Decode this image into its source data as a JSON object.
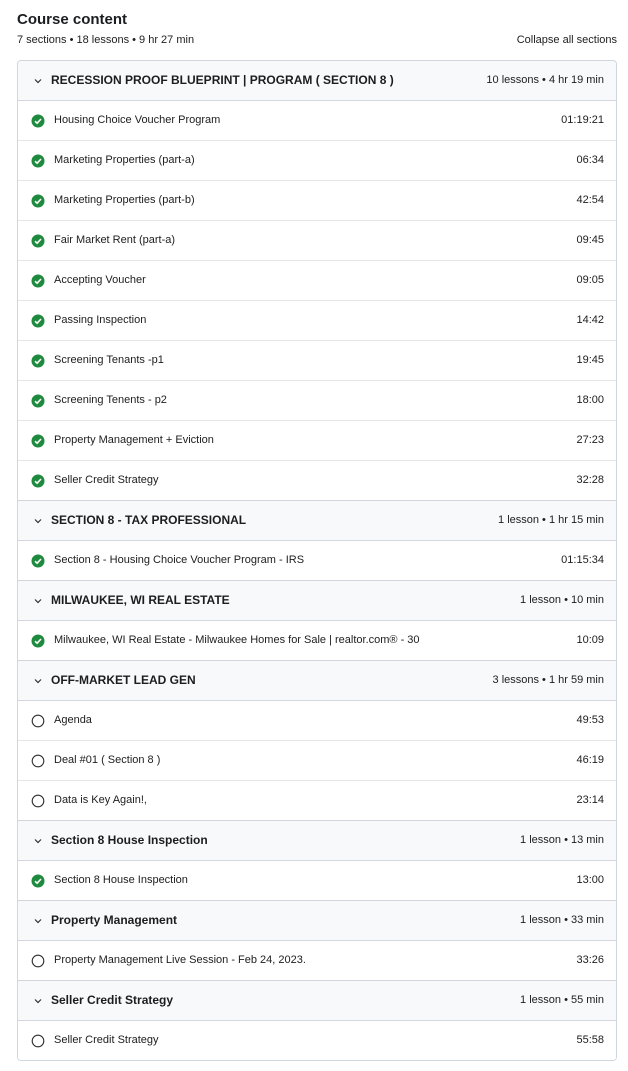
{
  "header": {
    "title": "Course content",
    "summary": "7 sections • 18 lessons • 9 hr 27 min",
    "collapse_label": "Collapse all sections"
  },
  "colors": {
    "complete": "#1e8a3e",
    "border": "#d1d7dc",
    "section_bg": "#f7f9fa"
  },
  "sections": [
    {
      "title": "RECESSION PROOF BLUEPRINT | PROGRAM ( SECTION 8 )",
      "meta": "10 lessons • 4 hr 19 min",
      "lessons": [
        {
          "title": "Housing Choice Voucher Program",
          "duration": "01:19:21",
          "complete": true
        },
        {
          "title": "Marketing Properties (part-a)",
          "duration": "06:34",
          "complete": true
        },
        {
          "title": "Marketing Properties (part-b)",
          "duration": "42:54",
          "complete": true
        },
        {
          "title": "Fair Market Rent (part-a)",
          "duration": "09:45",
          "complete": true
        },
        {
          "title": "Accepting Voucher",
          "duration": "09:05",
          "complete": true
        },
        {
          "title": "Passing Inspection",
          "duration": "14:42",
          "complete": true
        },
        {
          "title": "Screening Tenants -p1",
          "duration": "19:45",
          "complete": true
        },
        {
          "title": "Screening Tenents - p2",
          "duration": "18:00",
          "complete": true
        },
        {
          "title": "Property Management + Eviction",
          "duration": "27:23",
          "complete": true
        },
        {
          "title": "Seller Credit Strategy",
          "duration": "32:28",
          "complete": true
        }
      ]
    },
    {
      "title": "SECTION 8 - TAX PROFESSIONAL",
      "meta": "1 lesson • 1 hr 15 min",
      "lessons": [
        {
          "title": "Section 8 - Housing Choice Voucher Program - IRS",
          "duration": "01:15:34",
          "complete": true
        }
      ]
    },
    {
      "title": "MILWAUKEE, WI REAL ESTATE",
      "meta": "1 lesson • 10 min",
      "lessons": [
        {
          "title": "Milwaukee, WI Real Estate - Milwaukee Homes for Sale | realtor.com® - 30",
          "duration": "10:09",
          "complete": true
        }
      ]
    },
    {
      "title": "OFF-MARKET LEAD GEN",
      "meta": "3 lessons • 1 hr 59 min",
      "lessons": [
        {
          "title": "Agenda",
          "duration": "49:53",
          "complete": false
        },
        {
          "title": "Deal #01 ( Section 8 )",
          "duration": "46:19",
          "complete": false
        },
        {
          "title": "Data is Key Again!,",
          "duration": "23:14",
          "complete": false
        }
      ]
    },
    {
      "title": "Section 8 House Inspection",
      "meta": "1 lesson • 13 min",
      "lessons": [
        {
          "title": "Section 8 House Inspection",
          "duration": "13:00",
          "complete": true
        }
      ]
    },
    {
      "title": "Property Management",
      "meta": "1 lesson • 33 min",
      "lessons": [
        {
          "title": "Property Management Live Session - Feb 24, 2023.",
          "duration": "33:26",
          "complete": false
        }
      ]
    },
    {
      "title": "Seller Credit Strategy",
      "meta": "1 lesson • 55 min",
      "lessons": [
        {
          "title": "Seller Credit Strategy",
          "duration": "55:58",
          "complete": false
        }
      ]
    }
  ]
}
